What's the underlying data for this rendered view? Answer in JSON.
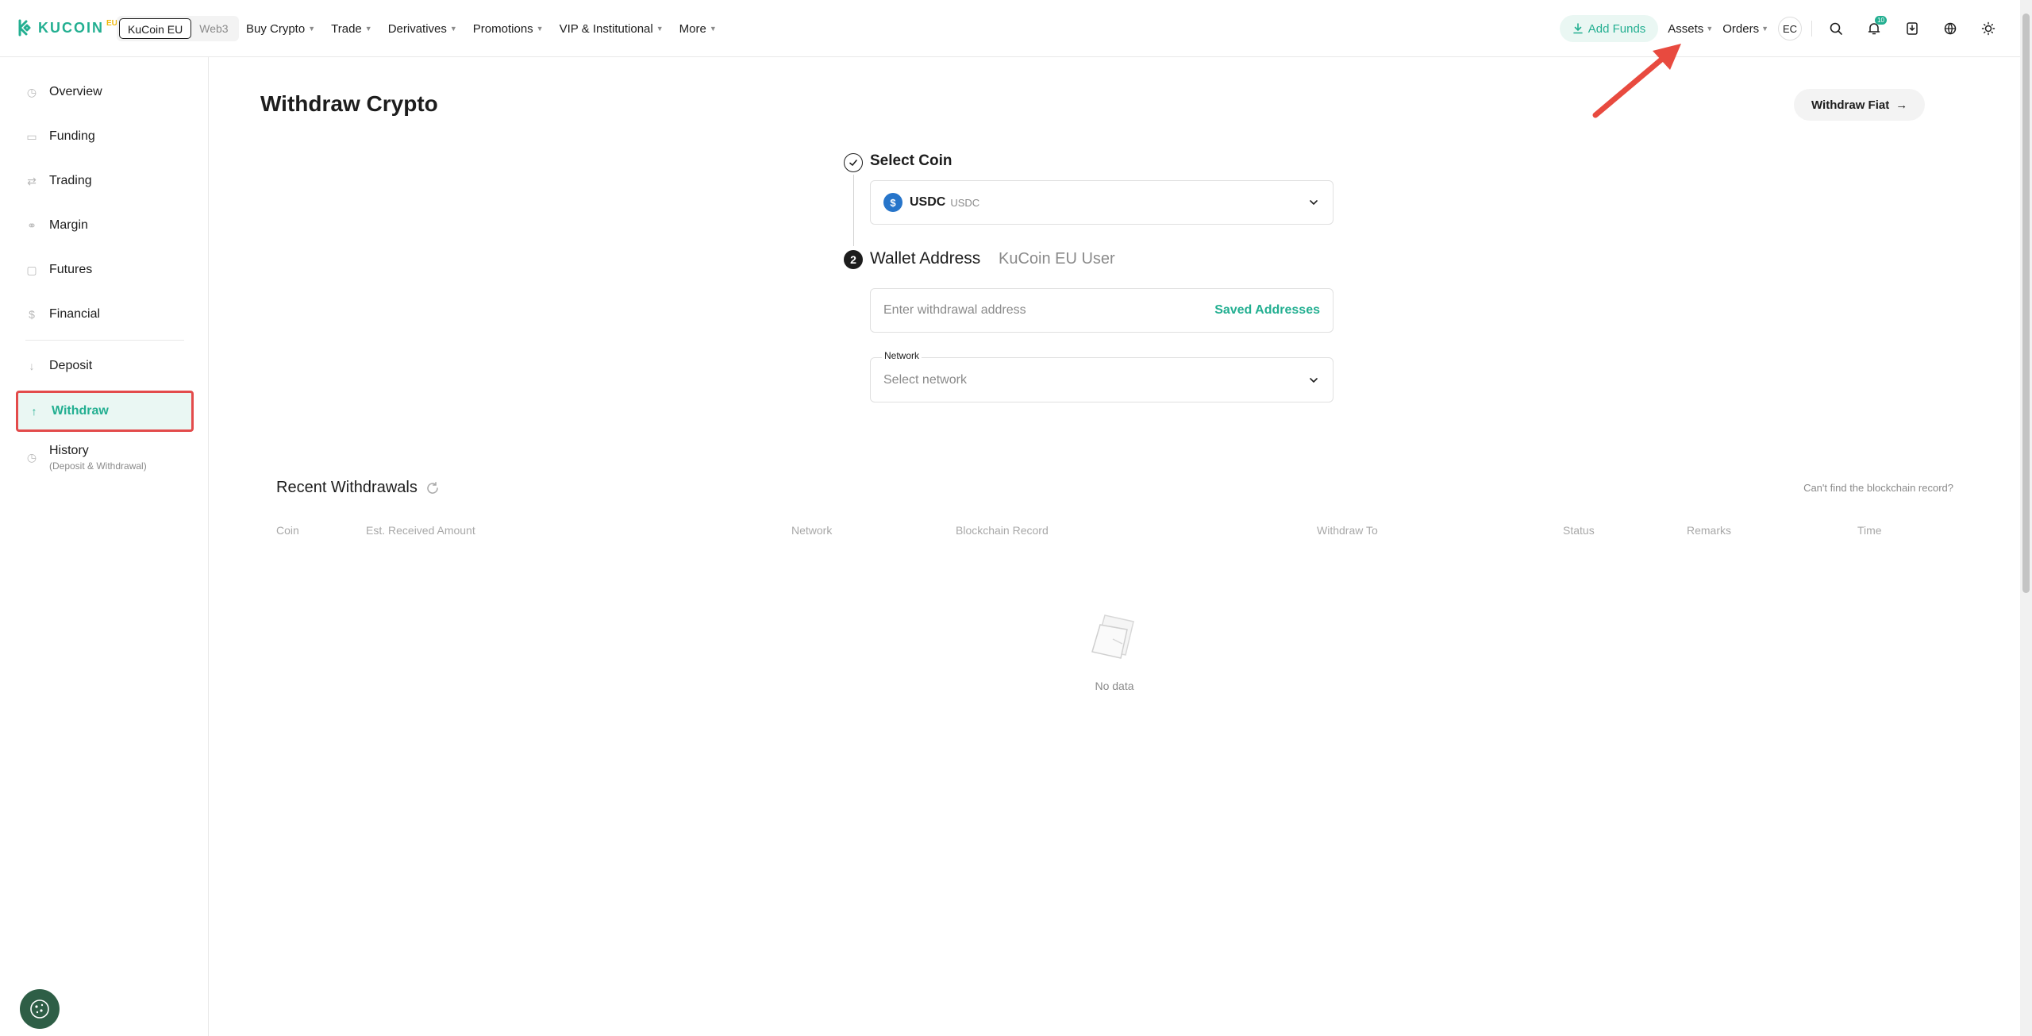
{
  "header": {
    "logo_text": "KUCOIN",
    "logo_sup": "EU",
    "env": [
      "KuCoin EU",
      "Web3"
    ],
    "nav": [
      "Buy Crypto",
      "Trade",
      "Derivatives",
      "Promotions",
      "VIP & Institutional",
      "More"
    ],
    "add_funds": "Add Funds",
    "assets": "Assets",
    "orders": "Orders",
    "avatar": "EC",
    "notif_badge": "10"
  },
  "sidebar": {
    "items": [
      "Overview",
      "Funding",
      "Trading",
      "Margin",
      "Futures",
      "Financial",
      "Deposit",
      "Withdraw",
      "History"
    ],
    "history_sub": "(Deposit & Withdrawal)"
  },
  "main": {
    "title": "Withdraw Crypto",
    "withdraw_fiat": "Withdraw Fiat",
    "step1_label": "Select Coin",
    "coin_symbol": "USDC",
    "coin_name": "USDC",
    "step2_number": "2",
    "step2_label": "Wallet Address",
    "step2_alt": "KuCoin EU User",
    "address_placeholder": "Enter withdrawal address",
    "saved_addresses": "Saved Addresses",
    "network_label": "Network",
    "network_placeholder": "Select network"
  },
  "recent": {
    "title": "Recent Withdrawals",
    "cant_find": "Can't find the blockchain record?",
    "columns": [
      "Coin",
      "Est. Received Amount",
      "Network",
      "Blockchain Record",
      "Withdraw To",
      "Status",
      "Remarks",
      "Time"
    ],
    "empty": "No data"
  },
  "colors": {
    "brand": "#23af91",
    "highlight": "#e34b4b"
  }
}
